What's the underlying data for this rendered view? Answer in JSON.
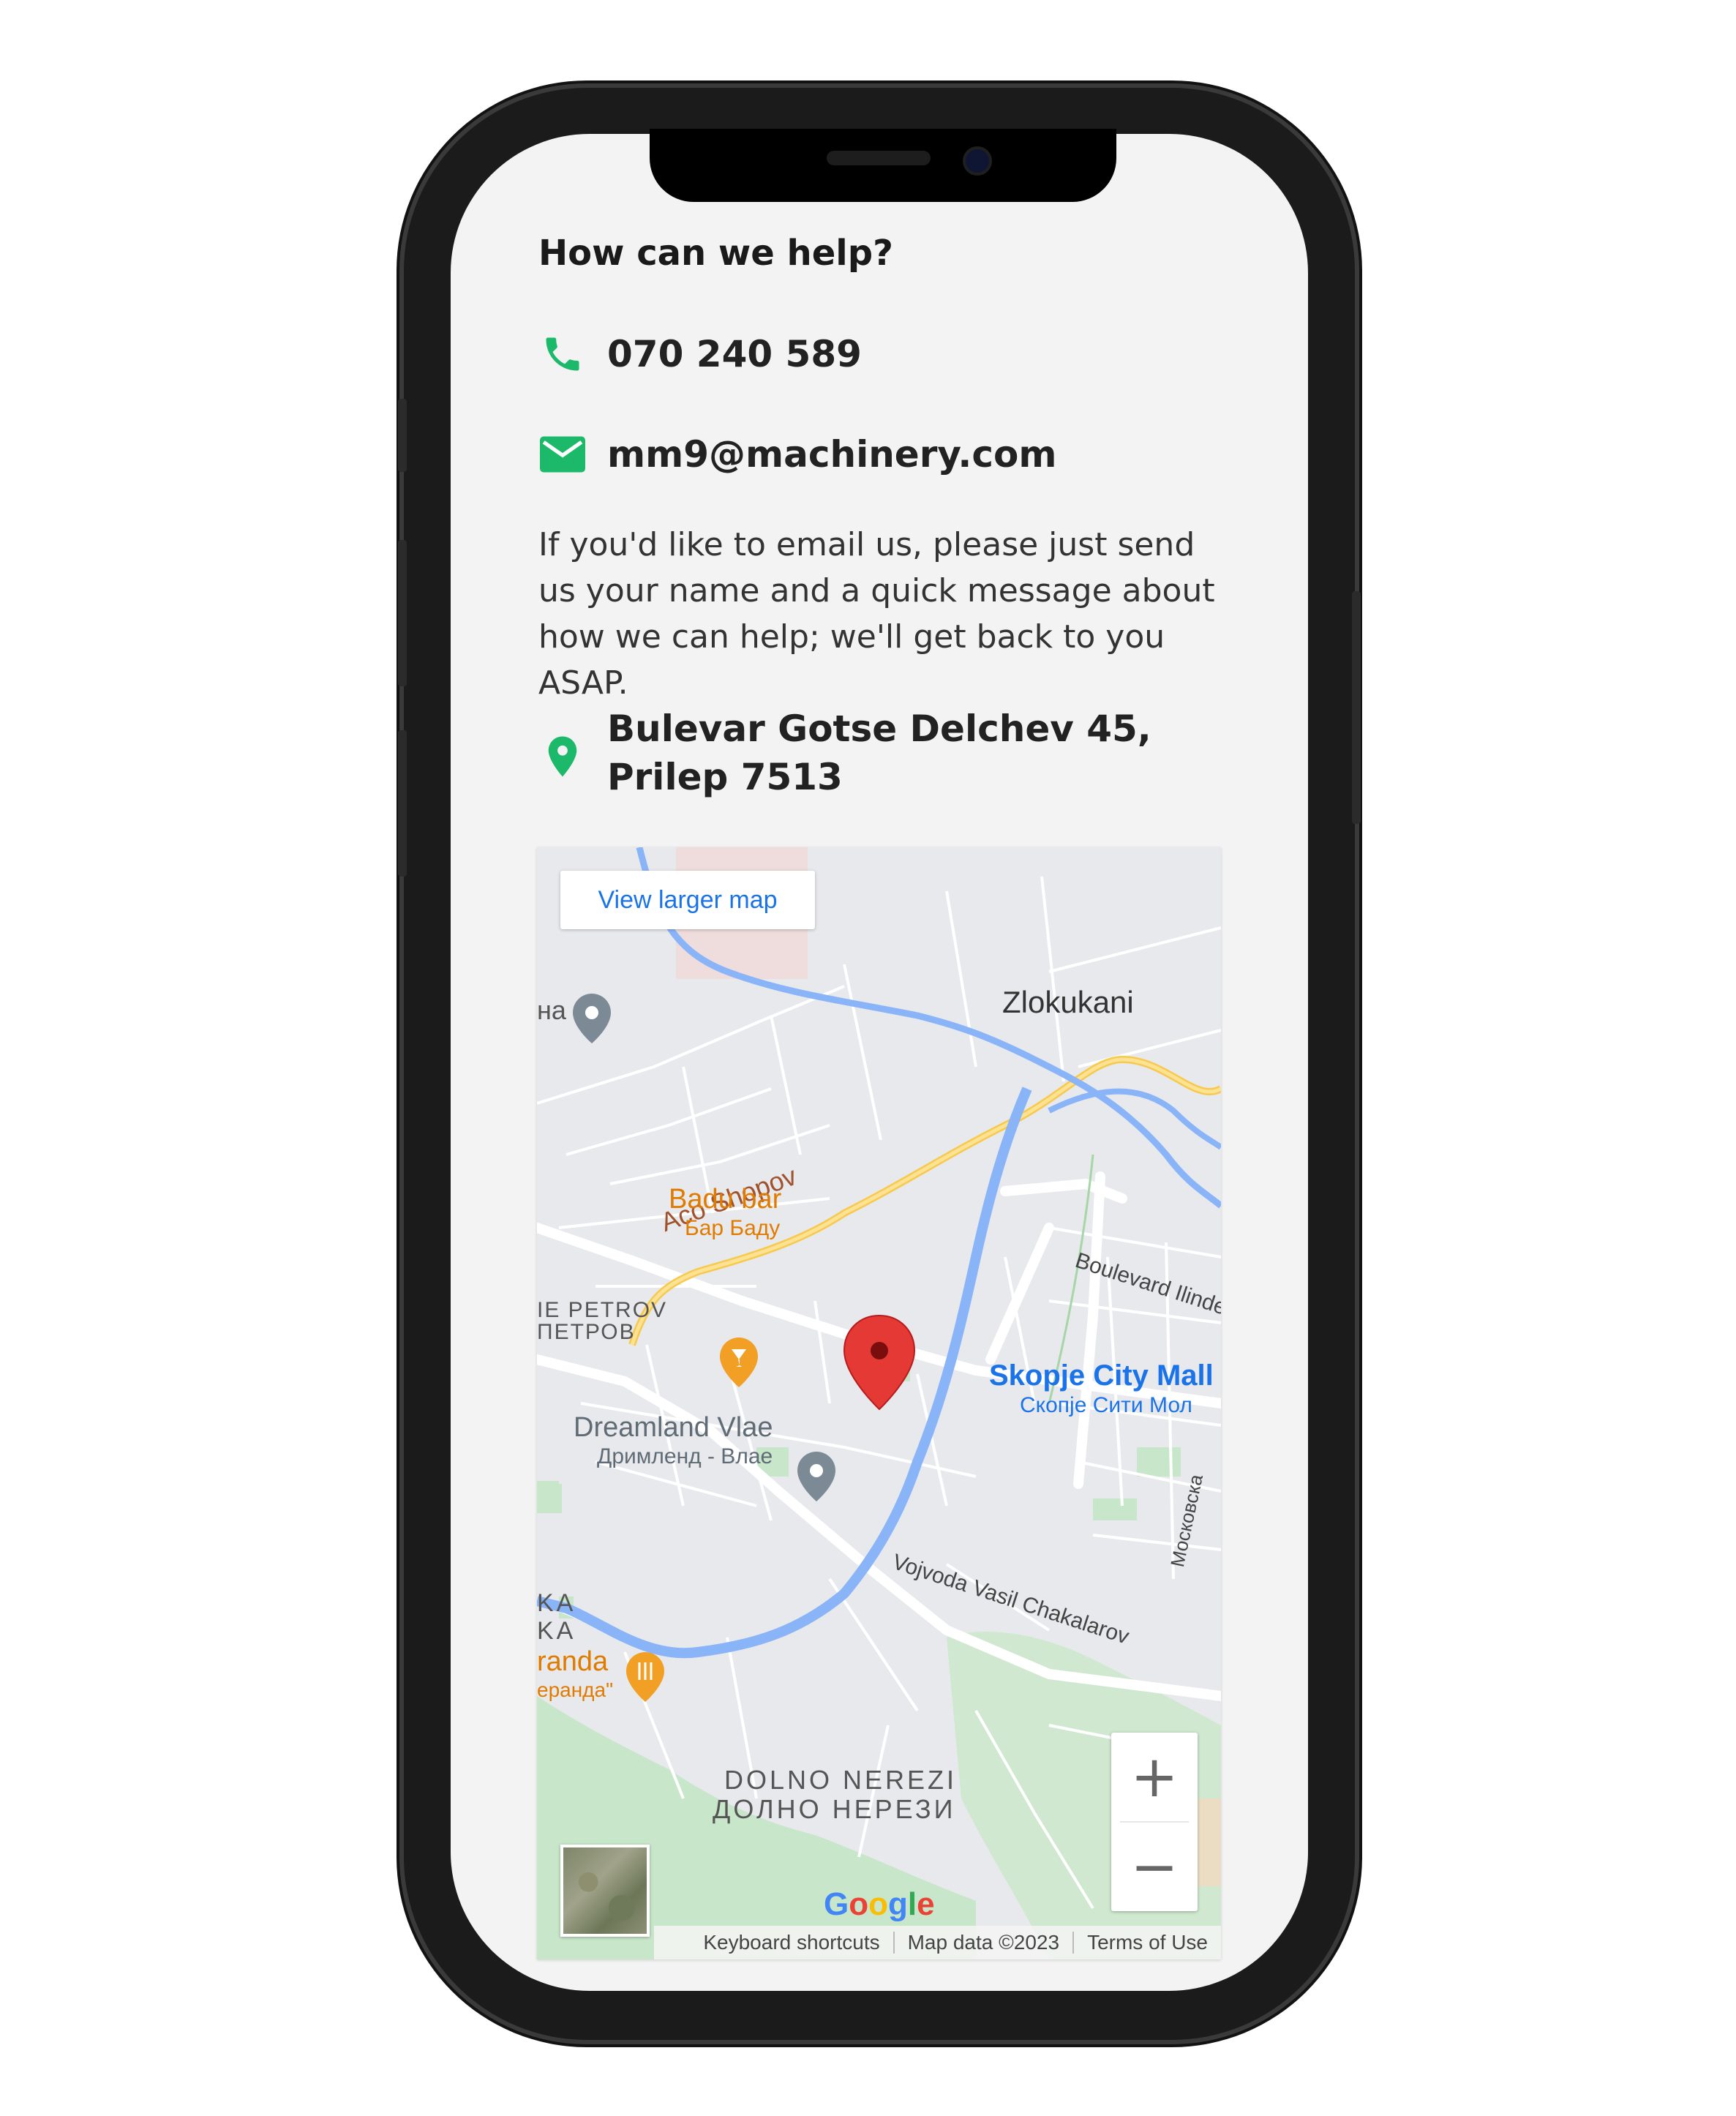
{
  "contact": {
    "heading": "How can we help?",
    "phone": "070 240 589",
    "email": "mm9@machinery.com",
    "message": "If you'd like to email us, please just send us your name and a quick message about how we can help; we'll get back to you ASAP.",
    "address": "Bulevar Gotse Delchev 45, Prilep 7513",
    "accent_color": "#1db96b"
  },
  "map": {
    "view_larger": "View larger map",
    "zoom_in": "+",
    "zoom_out": "−",
    "google": "Google",
    "footer": {
      "shortcuts": "Keyboard shortcuts",
      "map_data": "Map data ©2023",
      "terms": "Terms of Use"
    },
    "labels": {
      "zlokukani": "Zlokukani",
      "badu_bar": "Badu bar",
      "badu_bar_cyr": "Бар Баду",
      "aco_shopov": "Aco Shopov",
      "petrov": "IE PETROV",
      "petrov_cyr": "ПЕТРОВ",
      "city_mall": "Skopje City Mall",
      "city_mall_cyr": "Скопје Сити Мол",
      "dreamland": "Dreamland Vlae",
      "dreamland_cyr": "Дримленд - Влае",
      "blvd_ilinden": "Boulevard Ilinde",
      "vojvoda": "Vojvoda Vasil Chakalarov",
      "moskovska": "Московска",
      "ka1": "KA",
      "ka2": "KA",
      "veranda": "randa",
      "veranda_cyr": "еранда\"",
      "nerezi": "DOLNO NEREZI",
      "nerezi_cyr": "ДОЛНО НЕРЕЗИ",
      "na": "на"
    }
  }
}
